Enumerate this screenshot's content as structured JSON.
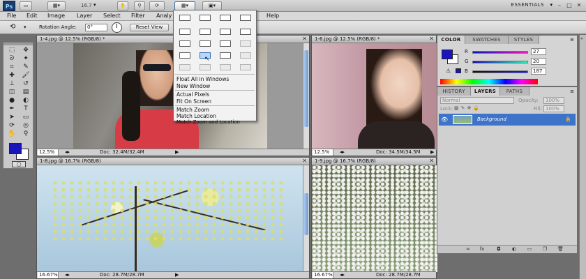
{
  "app": {
    "logo": "Ps",
    "zoom": "16.7",
    "workspace": "ESSENTIALS"
  },
  "menu": [
    "File",
    "Edit",
    "Image",
    "Layer",
    "Select",
    "Filter",
    "Analy",
    "Help"
  ],
  "options": {
    "rotation_label": "Rotation Angle:",
    "rotation_value": "0°",
    "reset_label": "Reset View"
  },
  "arrange_menu": {
    "items": [
      "Float All in Windows",
      "New Window",
      "Actual Pixels",
      "Fit On Screen",
      "Match Zoom",
      "Match Location",
      "Match Zoom and Location"
    ]
  },
  "documents": [
    {
      "title": "1-4.jpg @ 12.5% (RGB/8) *",
      "zoom": "12.5%",
      "doc": "Doc: 32.4M/32.4M"
    },
    {
      "title": "1-6.jpg @ 12.5% (RGB/8) *",
      "zoom": "12.5%",
      "doc": "Doc: 34.5M/34.5M"
    },
    {
      "title": "1-8.jpg @ 16.7% (RGB/8)",
      "zoom": "16.67%",
      "doc": "Doc: 28.7M/28.7M"
    },
    {
      "title": "1-9.jpg @ 16.7% (RGB/8)",
      "zoom": "16.67%",
      "doc": "Doc: 28.7M/28.7M"
    }
  ],
  "color_panel": {
    "tabs": [
      "COLOR",
      "SWATCHES",
      "STYLES"
    ],
    "r": "27",
    "g": "20",
    "b": "187",
    "r_label": "R",
    "g_label": "G",
    "b_label": "B",
    "fg_color": "#1b14bb"
  },
  "layers_panel": {
    "tabs": [
      "HISTORY",
      "LAYERS",
      "PATHS"
    ],
    "blend_mode": "Normal",
    "opacity_label": "Opacity:",
    "opacity_value": "100%",
    "lock_label": "Lock:",
    "fill_label": "Fill:",
    "fill_value": "100%",
    "layer_name": "Background"
  }
}
